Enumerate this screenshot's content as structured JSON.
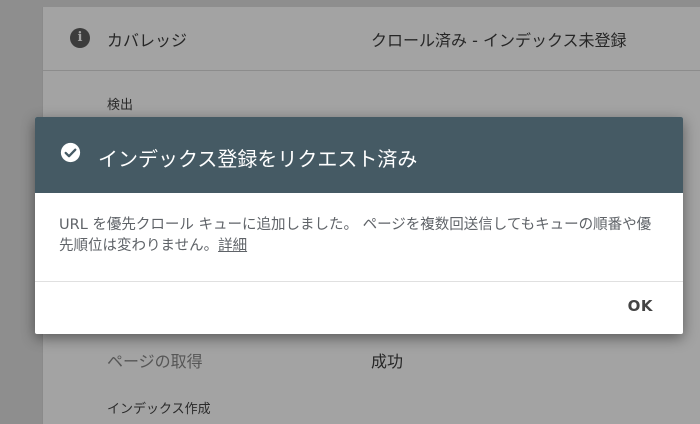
{
  "background": {
    "coverage": {
      "label": "カバレッジ",
      "value": "クロール済み - インデックス未登録",
      "icon": "info-icon"
    },
    "detect_heading": "検出",
    "fetch": {
      "label": "ページの取得",
      "value": "成功"
    },
    "index_heading": "インデックス作成"
  },
  "dialog": {
    "title": "インデックス登録をリクエスト済み",
    "icon": "check-circle-icon",
    "header_color": "#455a64",
    "body_text": "URL を優先クロール キューに追加しました。 ページを複数回送信してもキューの順番や優先順位は変わりません。",
    "link_text": "詳細",
    "ok_label": "OK"
  }
}
